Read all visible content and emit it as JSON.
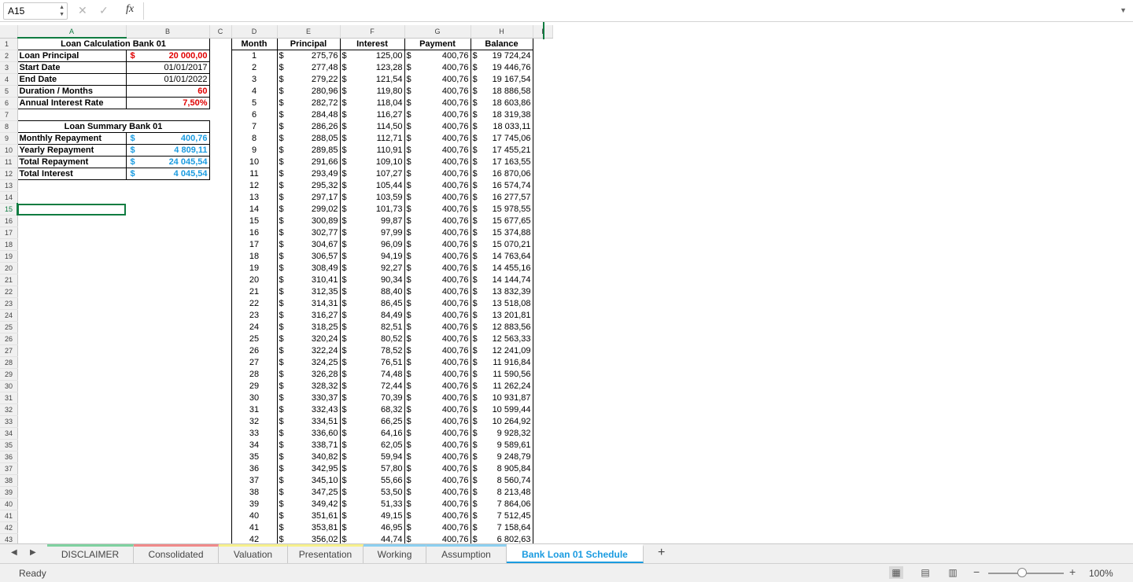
{
  "formula_bar": {
    "name_box": "A15",
    "formula": ""
  },
  "columns": [
    "A",
    "B",
    "C",
    "D",
    "E",
    "F",
    "G",
    "H",
    "I"
  ],
  "selected": {
    "column": "A",
    "row": 15
  },
  "loan_calc": {
    "title": "Loan Calculation Bank 01",
    "rows": [
      {
        "label": "Loan Principal",
        "prefix": "$",
        "value": "20 000,00",
        "style": "red"
      },
      {
        "label": "Start Date",
        "prefix": "",
        "value": "01/01/2017",
        "style": ""
      },
      {
        "label": "End Date",
        "prefix": "",
        "value": "01/01/2022",
        "style": ""
      },
      {
        "label": "Duration / Months",
        "prefix": "",
        "value": "60",
        "style": "red"
      },
      {
        "label": "Annual Interest Rate",
        "prefix": "",
        "value": "7,50%",
        "style": "red"
      }
    ]
  },
  "loan_summary": {
    "title": "Loan Summary Bank 01",
    "rows": [
      {
        "label": "Monthly Repayment",
        "prefix": "$",
        "value": "400,76"
      },
      {
        "label": "Yearly Repayment",
        "prefix": "$",
        "value": "4 809,11"
      },
      {
        "label": "Total Repayment",
        "prefix": "$",
        "value": "24 045,54"
      },
      {
        "label": "Total Interest",
        "prefix": "$",
        "value": "4 045,54"
      }
    ]
  },
  "schedule": {
    "headers": {
      "month": "Month",
      "principal": "Principal",
      "interest": "Interest",
      "payment": "Payment",
      "balance": "Balance"
    },
    "currency": "$",
    "rows": [
      [
        "1",
        "275,76",
        "125,00",
        "400,76",
        "19 724,24"
      ],
      [
        "2",
        "277,48",
        "123,28",
        "400,76",
        "19 446,76"
      ],
      [
        "3",
        "279,22",
        "121,54",
        "400,76",
        "19 167,54"
      ],
      [
        "4",
        "280,96",
        "119,80",
        "400,76",
        "18 886,58"
      ],
      [
        "5",
        "282,72",
        "118,04",
        "400,76",
        "18 603,86"
      ],
      [
        "6",
        "284,48",
        "116,27",
        "400,76",
        "18 319,38"
      ],
      [
        "7",
        "286,26",
        "114,50",
        "400,76",
        "18 033,11"
      ],
      [
        "8",
        "288,05",
        "112,71",
        "400,76",
        "17 745,06"
      ],
      [
        "9",
        "289,85",
        "110,91",
        "400,76",
        "17 455,21"
      ],
      [
        "10",
        "291,66",
        "109,10",
        "400,76",
        "17 163,55"
      ],
      [
        "11",
        "293,49",
        "107,27",
        "400,76",
        "16 870,06"
      ],
      [
        "12",
        "295,32",
        "105,44",
        "400,76",
        "16 574,74"
      ],
      [
        "13",
        "297,17",
        "103,59",
        "400,76",
        "16 277,57"
      ],
      [
        "14",
        "299,02",
        "101,73",
        "400,76",
        "15 978,55"
      ],
      [
        "15",
        "300,89",
        "99,87",
        "400,76",
        "15 677,65"
      ],
      [
        "16",
        "302,77",
        "97,99",
        "400,76",
        "15 374,88"
      ],
      [
        "17",
        "304,67",
        "96,09",
        "400,76",
        "15 070,21"
      ],
      [
        "18",
        "306,57",
        "94,19",
        "400,76",
        "14 763,64"
      ],
      [
        "19",
        "308,49",
        "92,27",
        "400,76",
        "14 455,16"
      ],
      [
        "20",
        "310,41",
        "90,34",
        "400,76",
        "14 144,74"
      ],
      [
        "21",
        "312,35",
        "88,40",
        "400,76",
        "13 832,39"
      ],
      [
        "22",
        "314,31",
        "86,45",
        "400,76",
        "13 518,08"
      ],
      [
        "23",
        "316,27",
        "84,49",
        "400,76",
        "13 201,81"
      ],
      [
        "24",
        "318,25",
        "82,51",
        "400,76",
        "12 883,56"
      ],
      [
        "25",
        "320,24",
        "80,52",
        "400,76",
        "12 563,33"
      ],
      [
        "26",
        "322,24",
        "78,52",
        "400,76",
        "12 241,09"
      ],
      [
        "27",
        "324,25",
        "76,51",
        "400,76",
        "11 916,84"
      ],
      [
        "28",
        "326,28",
        "74,48",
        "400,76",
        "11 590,56"
      ],
      [
        "29",
        "328,32",
        "72,44",
        "400,76",
        "11 262,24"
      ],
      [
        "30",
        "330,37",
        "70,39",
        "400,76",
        "10 931,87"
      ],
      [
        "31",
        "332,43",
        "68,32",
        "400,76",
        "10 599,44"
      ],
      [
        "32",
        "334,51",
        "66,25",
        "400,76",
        "10 264,92"
      ],
      [
        "33",
        "336,60",
        "64,16",
        "400,76",
        "9 928,32"
      ],
      [
        "34",
        "338,71",
        "62,05",
        "400,76",
        "9 589,61"
      ],
      [
        "35",
        "340,82",
        "59,94",
        "400,76",
        "9 248,79"
      ],
      [
        "36",
        "342,95",
        "57,80",
        "400,76",
        "8 905,84"
      ],
      [
        "37",
        "345,10",
        "55,66",
        "400,76",
        "8 560,74"
      ],
      [
        "38",
        "347,25",
        "53,50",
        "400,76",
        "8 213,48"
      ],
      [
        "39",
        "349,42",
        "51,33",
        "400,76",
        "7 864,06"
      ],
      [
        "40",
        "351,61",
        "49,15",
        "400,76",
        "7 512,45"
      ],
      [
        "41",
        "353,81",
        "46,95",
        "400,76",
        "7 158,64"
      ],
      [
        "42",
        "356,02",
        "44,74",
        "400,76",
        "6 802,63"
      ]
    ]
  },
  "sheet_tabs": [
    {
      "label": "DISCLAIMER",
      "color": "#7fd1a0",
      "active": false
    },
    {
      "label": "Consolidated",
      "color": "#f08a8a",
      "active": false
    },
    {
      "label": "Valuation",
      "color": "#f6f08c",
      "active": false
    },
    {
      "label": "Presentation",
      "color": "#f6f08c",
      "active": false
    },
    {
      "label": "Working",
      "color": "#8ccff0",
      "active": false
    },
    {
      "label": "Assumption",
      "color": "#8ccff0",
      "active": false
    },
    {
      "label": "Bank Loan 01 Schedule",
      "color": "#1a9be0",
      "active": true
    }
  ],
  "status": {
    "text": "Ready",
    "zoom": "100%",
    "zoom_fraction": 0.45
  }
}
